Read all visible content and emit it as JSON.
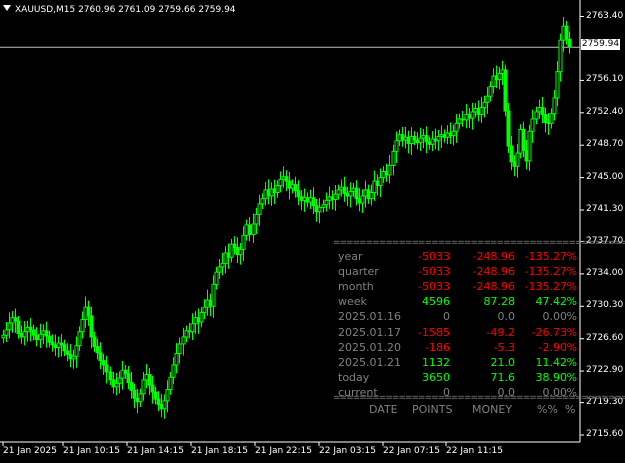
{
  "header": {
    "text": "XAUUSD,M15  2760.96 2761.09 2759.66 2759.94"
  },
  "current_price": "2759.94",
  "price_labels": [
    "2763.40",
    "2756.10",
    "2752.40",
    "2748.70",
    "2745.00",
    "2741.30",
    "2737.70",
    "2734.00",
    "2730.30",
    "2726.60",
    "2722.90",
    "2719.30",
    "2715.60"
  ],
  "time_labels": [
    "21 Jan 2025",
    "21 Jan 10:15",
    "21 Jan 14:15",
    "21 Jan 18:15",
    "21 Jan 22:15",
    "22 Jan 03:15",
    "22 Jan 07:15",
    "22 Jan 11:15"
  ],
  "colors": {
    "background": "#000000",
    "bull_candle": "#00ff00",
    "positive": "#00ff00",
    "negative": "#ff0000",
    "neutral": "#808080",
    "text": "#ffffff",
    "price_line": "#c0c0c0"
  },
  "stats": {
    "separator": "==============================================",
    "rows": [
      {
        "label": "year",
        "points": "-5033",
        "money": "-248.96",
        "pct": "-135.27",
        "sign": "%",
        "state": "neg"
      },
      {
        "label": "quarter",
        "points": "-5033",
        "money": "-248.96",
        "pct": "-135.27",
        "sign": "%",
        "state": "neg"
      },
      {
        "label": " month",
        "points": "-5033",
        "money": "-248.96",
        "pct": "-135.27",
        "sign": "%",
        "state": "neg"
      },
      {
        "label": "week",
        "points": "4596",
        "money": "87.28",
        "pct": "47.42",
        "sign": "%",
        "state": "pos"
      },
      {
        "label": "2025.01.16",
        "points": "0",
        "money": "0.0",
        "pct": "0.00",
        "sign": "%",
        "state": "zero"
      },
      {
        "label": "2025.01.17",
        "points": "-1585",
        "money": "-49.2",
        "pct": "-26.73",
        "sign": "%",
        "state": "neg"
      },
      {
        "label": "2025.01.20",
        "points": "-186",
        "money": "-5.3",
        "pct": "-2.90",
        "sign": "%",
        "state": "neg"
      },
      {
        "label": "2025.01.21",
        "points": "1132",
        "money": "21.0",
        "pct": "11.42",
        "sign": "%",
        "state": "pos"
      },
      {
        "label": "today",
        "points": "3650",
        "money": "71.6",
        "pct": "38.90",
        "sign": "%",
        "state": "pos"
      },
      {
        "label": "current",
        "points": "0",
        "money": "0.0",
        "pct": "0.00",
        "sign": "%",
        "state": "zero"
      }
    ],
    "footer": {
      "date": "DATE",
      "points": "POINTS",
      "money": "MONEY",
      "pct": "%%",
      "sign": "%"
    }
  },
  "chart_data": {
    "type": "candlestick",
    "symbol": "XAUUSD",
    "timeframe": "M15",
    "ylim": [
      2714.8,
      2764.6
    ],
    "current_price": 2759.94,
    "closes": [
      2727.0,
      2727.6,
      2728.4,
      2729.0,
      2728.6,
      2727.2,
      2726.8,
      2727.4,
      2727.9,
      2727.6,
      2727.0,
      2726.5,
      2727.1,
      2727.5,
      2726.9,
      2726.2,
      2725.9,
      2725.6,
      2726.1,
      2725.9,
      2725.2,
      2724.8,
      2724.3,
      2724.6,
      2725.8,
      2727.4,
      2728.8,
      2730.2,
      2729.2,
      2726.8,
      2725.7,
      2725.0,
      2724.1,
      2723.6,
      2722.8,
      2721.9,
      2721.1,
      2721.5,
      2722.1,
      2723.0,
      2722.6,
      2721.6,
      2720.7,
      2719.8,
      2719.4,
      2720.3,
      2721.9,
      2722.5,
      2721.3,
      2720.5,
      2719.7,
      2719.1,
      2718.6,
      2719.5,
      2720.8,
      2722.2,
      2723.6,
      2724.9,
      2726.0,
      2726.8,
      2727.5,
      2727.4,
      2728.3,
      2729.0,
      2728.5,
      2729.6,
      2730.2,
      2731.0,
      2730.3,
      2732.8,
      2734.2,
      2734.8,
      2735.2,
      2736.4,
      2735.9,
      2737.4,
      2737.0,
      2736.2,
      2736.8,
      2738.4,
      2739.6,
      2738.5,
      2739.7,
      2740.8,
      2742.0,
      2742.6,
      2743.6,
      2742.9,
      2743.7,
      2743.3,
      2744.1,
      2744.8,
      2745.1,
      2744.6,
      2743.8,
      2744.2,
      2743.5,
      2742.8,
      2742.4,
      2742.7,
      2742.2,
      2742.7,
      2741.8,
      2741.1,
      2741.6,
      2741.9,
      2742.4,
      2742.8,
      2742.5,
      2743.1,
      2743.6,
      2743.9,
      2743.2,
      2742.9,
      2743.4,
      2743.8,
      2742.6,
      2742.1,
      2742.9,
      2743.6,
      2742.6,
      2743.3,
      2744.6,
      2744.1,
      2745.0,
      2745.7,
      2745.3,
      2746.4,
      2748.0,
      2749.2,
      2749.9,
      2749.3,
      2749.6,
      2748.9,
      2749.7,
      2749.3,
      2749.0,
      2749.5,
      2749.8,
      2749.1,
      2748.8,
      2749.4,
      2749.2,
      2749.7,
      2749.9,
      2749.6,
      2750.1,
      2749.8,
      2750.3,
      2751.2,
      2751.7,
      2751.6,
      2752.2,
      2751.8,
      2752.5,
      2752.9,
      2752.2,
      2753.0,
      2753.6,
      2754.3,
      2755.4,
      2756.6,
      2756.2,
      2756.9,
      2757.3,
      2752.6,
      2748.6,
      2746.8,
      2746.3,
      2747.8,
      2750.5,
      2748.1,
      2746.9,
      2750.3,
      2751.7,
      2752.5,
      2753.0,
      2752.2,
      2751.3,
      2751.2,
      2752.3,
      2754.1,
      2757.1,
      2760.7,
      2762.3,
      2760.8,
      2759.94
    ]
  }
}
